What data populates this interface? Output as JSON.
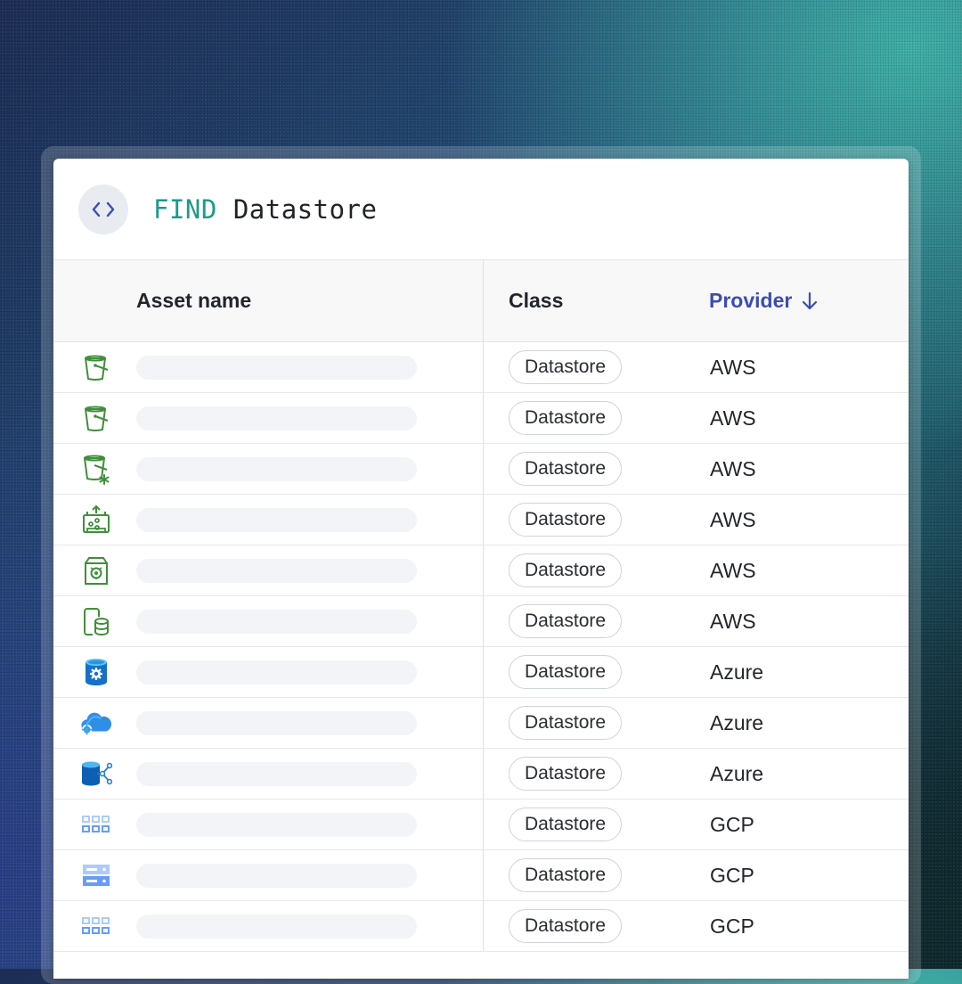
{
  "query": {
    "keyword": "FIND",
    "target": "Datastore"
  },
  "table": {
    "columns": {
      "asset": "Asset name",
      "class": "Class",
      "provider": "Provider"
    },
    "sort": {
      "column": "provider",
      "direction": "descending",
      "icon": "arrow-down-icon"
    },
    "rows": [
      {
        "icon": "aws-s3-bucket-icon",
        "class": "Datastore",
        "provider": "AWS"
      },
      {
        "icon": "aws-s3-bucket-icon",
        "class": "Datastore",
        "provider": "AWS"
      },
      {
        "icon": "aws-s3-glacier-icon",
        "class": "Datastore",
        "provider": "AWS"
      },
      {
        "icon": "aws-lake-formation-icon",
        "class": "Datastore",
        "provider": "AWS"
      },
      {
        "icon": "aws-backup-vault-icon",
        "class": "Datastore",
        "provider": "AWS"
      },
      {
        "icon": "aws-database-icon",
        "class": "Datastore",
        "provider": "AWS"
      },
      {
        "icon": "azure-sql-database-icon",
        "class": "Datastore",
        "provider": "Azure"
      },
      {
        "icon": "azure-cloud-storage-icon",
        "class": "Datastore",
        "provider": "Azure"
      },
      {
        "icon": "azure-database-network-icon",
        "class": "Datastore",
        "provider": "Azure"
      },
      {
        "icon": "gcp-storage-grid-icon",
        "class": "Datastore",
        "provider": "GCP"
      },
      {
        "icon": "gcp-server-icon",
        "class": "Datastore",
        "provider": "GCP"
      },
      {
        "icon": "gcp-storage-grid-icon",
        "class": "Datastore",
        "provider": "GCP"
      }
    ]
  },
  "colors": {
    "keyword": "#1d9a8a",
    "sorted_header": "#3c4db0",
    "aws_icon": "#3f8f3a",
    "azure_icon": "#1877d2",
    "gcp_icon": "#5b8ce8"
  }
}
